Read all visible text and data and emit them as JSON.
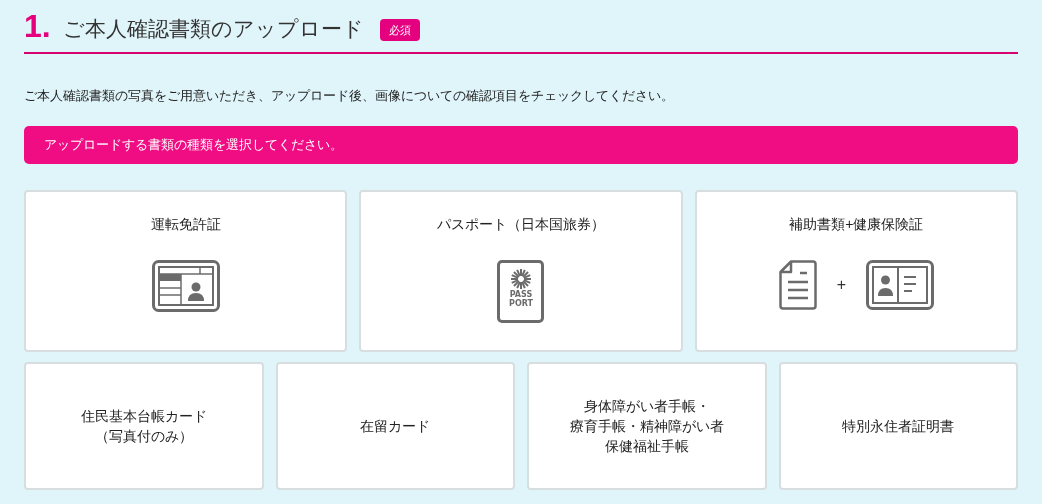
{
  "heading": {
    "number": "1.",
    "title": "ご本人確認書類のアップロード",
    "badge": "必須"
  },
  "description": "ご本人確認書類の写真をご用意いただき、アップロード後、画像についての確認項目をチェックしてください。",
  "alert": "アップロードする書類の種類を選択してください。",
  "primary_cards": [
    {
      "lines": [
        "運転免許証"
      ],
      "icons": [
        {
          "kind": "license"
        }
      ]
    },
    {
      "lines": [
        "パスポート（日本国旅券）"
      ],
      "icons": [
        {
          "kind": "passport",
          "lines": [
            "PASS",
            "PORT"
          ]
        }
      ]
    },
    {
      "lines": [
        "補助書類+健康保険証"
      ],
      "icons": [
        {
          "kind": "document"
        },
        {
          "kind": "plus",
          "text": "+"
        },
        {
          "kind": "insurance"
        }
      ]
    }
  ],
  "secondary_cards": [
    {
      "lines": [
        "住民基本台帳カード",
        "（写真付のみ）"
      ]
    },
    {
      "lines": [
        "在留カード"
      ]
    },
    {
      "lines": [
        "身体障がい者手帳・",
        "療育手帳・精神障がい者",
        "保健福祉手帳"
      ]
    },
    {
      "lines": [
        "特別永住者証明書"
      ]
    }
  ]
}
